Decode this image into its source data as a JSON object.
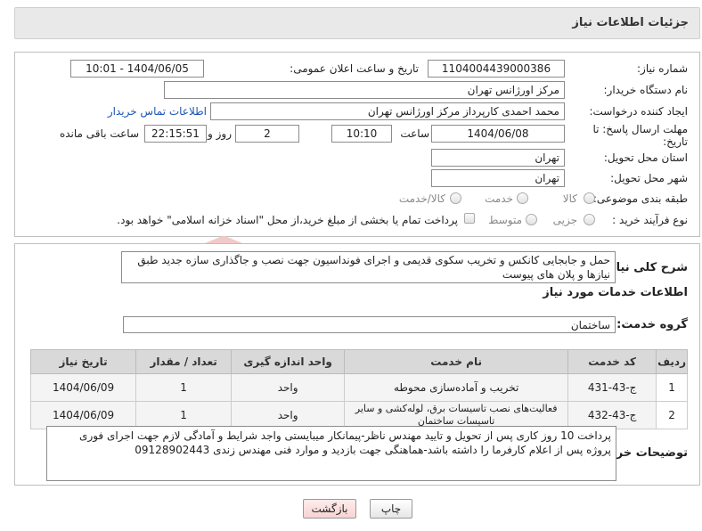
{
  "header": {
    "title": "جزئیات اطلاعات نیاز"
  },
  "form": {
    "need_number_label": "شماره نیاز:",
    "need_number": "1104004439000386",
    "announce_label": "تاریخ و ساعت اعلان عمومی:",
    "announce_value": "1404/06/05 - 10:01",
    "buyer_org_label": "نام دستگاه خریدار:",
    "buyer_org": "مرکز اورژانس تهران",
    "creator_label": "ایجاد کننده درخواست:",
    "creator": "محمد احمدی کارپرداز مرکز اورژانس تهران",
    "contact_link": "اطلاعات تماس خریدار",
    "deadline_label_1": "مهلت ارسال پاسخ: تا",
    "deadline_label_2": "تاریخ:",
    "deadline_date": "1404/06/08",
    "time_label": "ساعت",
    "deadline_time": "10:10",
    "days_value": "2",
    "days_label": "روز و",
    "remaining_time": "22:15:51",
    "remaining_label": "ساعت باقی مانده",
    "province_label": "استان محل تحویل:",
    "province": "تهران",
    "city_label": "شهر محل تحویل:",
    "city": "تهران",
    "category_label": "طبقه بندی موضوعی:",
    "category_options": [
      "کالا",
      "خدمت",
      "کالا/خدمت"
    ],
    "process_label": "نوع فرآیند خرید :",
    "process_options": [
      "جزیی",
      "متوسط"
    ],
    "payment_note": "پرداخت تمام یا بخشی از مبلغ خرید،از محل \"اسناد خزانه اسلامی\" خواهد بود."
  },
  "details": {
    "summary_label": "شرح کلی نیاز:",
    "summary": "حمل و جابجایی کانکس و تخریب سکوی قدیمی و اجرای فونداسیون جهت نصب و جاگذاری سازه جدید طبق نیازها و پلان های پیوست",
    "services_heading": "اطلاعات خدمات مورد نیاز",
    "group_label": "گروه خدمت:",
    "group_value": "ساختمان",
    "table": {
      "headers": [
        "ردیف",
        "کد خدمت",
        "نام خدمت",
        "واحد اندازه گیری",
        "تعداد / مقدار",
        "تاریخ نیاز"
      ],
      "rows": [
        [
          "1",
          "ج-43-431",
          "تخریب و آماده‌سازی محوطه",
          "واحد",
          "1",
          "1404/06/09"
        ],
        [
          "2",
          "ج-43-432",
          "فعالیت‌های نصب تاسیسات برق، لوله‌کشی و سایر تاسیسات ساختمان",
          "واحد",
          "1",
          "1404/06/09"
        ]
      ]
    },
    "buyer_notes_label": "توضیحات خریدار:",
    "buyer_notes": "پرداخت 10 روز کاری پس از تحویل و تایید مهندس ناظر-پیمانکار میبایستی واجد شرایط و آمادگی لازم جهت اجرای فوری پروژه پس از اعلام کارفرما را داشته باشد-هماهنگی جهت بازدید و موارد فنی مهندس زندی 09128902443"
  },
  "buttons": {
    "print": "چاپ",
    "back": "بازگشت"
  },
  "watermark": {
    "text": "AriaTender.neT"
  }
}
